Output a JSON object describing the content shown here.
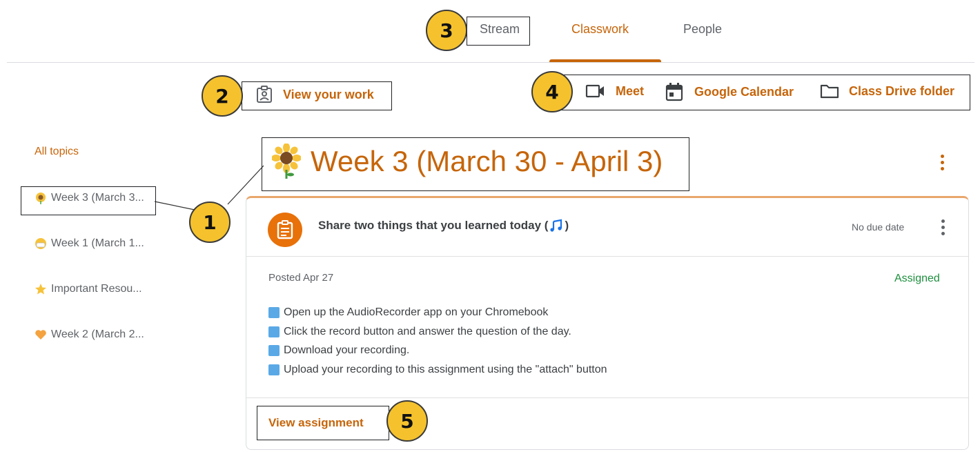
{
  "tabs": [
    {
      "label": "Stream"
    },
    {
      "label": "Classwork"
    },
    {
      "label": "People"
    }
  ],
  "badges": [
    "1",
    "2",
    "3",
    "4",
    "5"
  ],
  "actions": {
    "view_work": "View your work",
    "meet": "Meet",
    "calendar": "Google Calendar",
    "drive": "Class Drive folder"
  },
  "sidebar": {
    "all_topics": "All topics",
    "items": [
      {
        "label": "Week 3 (March 3...",
        "icon": "sunflower-icon"
      },
      {
        "label": "Week 1 (March 1...",
        "icon": "face-mask-icon"
      },
      {
        "label": "Important Resou...",
        "icon": "star-icon"
      },
      {
        "label": "Week 2 (March 2...",
        "icon": "heart-icon"
      }
    ]
  },
  "topic": {
    "title": "Week 3 (March 30 - April 3)",
    "icon": "sunflower-icon"
  },
  "assignment": {
    "title": "Share two things that you learned today (",
    "title_suffix": ")",
    "music_icon": "musical-notes-icon",
    "due": "No due date",
    "posted": "Posted Apr 27",
    "status": "Assigned",
    "steps": [
      "Open up the AudioRecorder app on your Chromebook",
      "Click the record button and answer the question of the day.",
      "Download your recording.",
      "Upload your recording to this assignment using the \"attach\" button"
    ],
    "view_label": "View assignment"
  },
  "colors": {
    "accent": "#c6650a",
    "badge": "#f5c22d",
    "assigned": "#1e8e3e",
    "step_icon": "#5aa9e6"
  }
}
